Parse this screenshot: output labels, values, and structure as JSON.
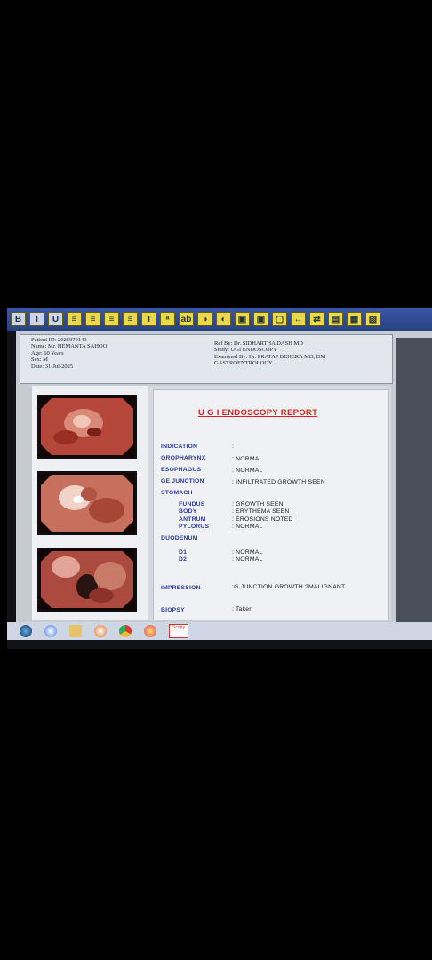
{
  "toolbar": {
    "icons": [
      "bold-icon",
      "italic-icon",
      "underline-icon",
      "align-left-icon",
      "align-center-icon",
      "align-right-icon",
      "align-justify-icon",
      "text-icon",
      "font-size-icon",
      "spell-icon",
      "palette-icon",
      "contrast-icon",
      "image-icon",
      "capture-icon",
      "crop-icon",
      "resize-icon",
      "swap-icon",
      "page-icon",
      "save-icon",
      "print-icon"
    ],
    "glyphs": [
      "B",
      "I",
      "U",
      "≡",
      "≡",
      "≡",
      "≡",
      "T",
      "ᵃ",
      "ab",
      "◑",
      "◐",
      "▣",
      "▣",
      "▢",
      "↔",
      "⇄",
      "▤",
      "▦",
      "▧"
    ]
  },
  "patient": {
    "id_line": "Patient ID: 2025070149",
    "name_line": "Name: Mr. HEMANTA SAHOO",
    "age_line": "Age: 60 Years",
    "sex_line": "Sex: M",
    "date_line": "Date: 31-Jul-2025"
  },
  "referral": {
    "ref_line": "Ref By: Dr. SIDHARTHA  DASH MD",
    "study_line": "Study: UGI ENDOSCOPY",
    "examined_line": "Examined By: Dr. PRATAP  BEHERA MD, DM",
    "dept_line": "GASTROENTROLOGY"
  },
  "report": {
    "title": "U G I ENDOSCOPY REPORT",
    "rows": [
      {
        "label": "INDICATION",
        "value": ":"
      },
      {
        "label": "OROPHARYNX",
        "value": ":  NORMAL"
      },
      {
        "label": "ESOPHAGUS",
        "value": ":  NORMAL"
      },
      {
        "label": "GE JUNCTION",
        "value": ":  INFILTRATED GROWTH SEEN"
      },
      {
        "label": "STOMACH",
        "value": ""
      },
      {
        "label": "FUNDUS",
        "value": ":  GROWTH SEEN"
      },
      {
        "label": "BODY",
        "value": ":  ERYTHEMA SEEN"
      },
      {
        "label": "ANTRUM",
        "value": ":  EROSIONS NOTED"
      },
      {
        "label": "PYLORUS",
        "value": ":  NORMAL"
      },
      {
        "label": "DUODENUM",
        "value": ""
      },
      {
        "label": "D1",
        "value": ":  NORMAL"
      },
      {
        "label": "D2",
        "value": ":  NORMAL"
      },
      {
        "label": "IMPRESSION",
        "value": ":G JUNCTION  GROWTH ?MALIGNANT"
      },
      {
        "label": "BIOPSY",
        "value": ":  Taken"
      }
    ]
  },
  "taskbar": {
    "scope_label": "Scopy"
  },
  "colors": {
    "title_red": "#d22222",
    "label_blue": "#2a3c9a"
  }
}
